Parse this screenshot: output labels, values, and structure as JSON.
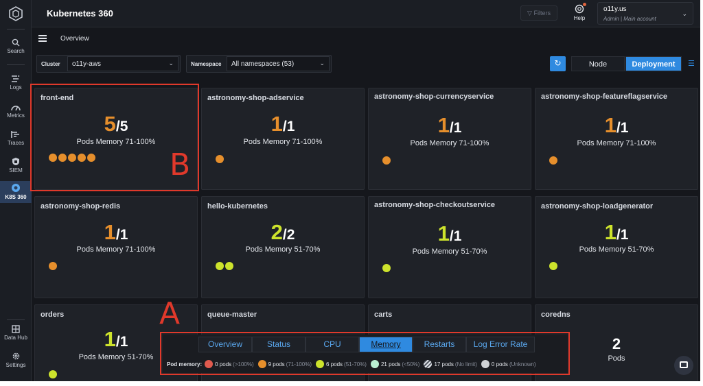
{
  "header": {
    "title": "Kubernetes 360",
    "filters_label": "Filters",
    "help_label": "Help",
    "account_name": "o11y.us",
    "account_sub": "Admin  |  Main account"
  },
  "sidebar": {
    "items": [
      {
        "label": "Search",
        "icon": "search-icon"
      },
      {
        "label": "Logs",
        "icon": "logs-icon"
      },
      {
        "label": "Metrics",
        "icon": "metrics-icon"
      },
      {
        "label": "Traces",
        "icon": "traces-icon"
      },
      {
        "label": "SIEM",
        "icon": "siem-icon"
      },
      {
        "label": "K8S 360",
        "icon": "k8s-icon"
      },
      {
        "label": "Data Hub",
        "icon": "data-hub-icon"
      },
      {
        "label": "Settings",
        "icon": "gear-icon"
      }
    ]
  },
  "breadcrumb": {
    "current": "Overview"
  },
  "filters": {
    "cluster_label": "Cluster",
    "cluster_value": "o11y-aws",
    "namespace_label": "Namespace",
    "namespace_value": "All namespaces (53)",
    "view_node": "Node",
    "view_deployment": "Deployment"
  },
  "cards": [
    {
      "title": "front-end",
      "ready": "5",
      "total": "/5",
      "caption": "Pods Memory 71-100%",
      "color": "orange",
      "dots": 5
    },
    {
      "title": "astronomy-shop-adservice",
      "ready": "1",
      "total": "/1",
      "caption": "Pods Memory 71-100%",
      "color": "orange",
      "dots": 1
    },
    {
      "title": "astronomy-shop-currencyservice",
      "ready": "1",
      "total": "/1",
      "caption": "Pods Memory 71-100%",
      "color": "orange",
      "dots": 1
    },
    {
      "title": "astronomy-shop-featureflagservice",
      "ready": "1",
      "total": "/1",
      "caption": "Pods Memory 71-100%",
      "color": "orange",
      "dots": 1
    },
    {
      "title": "astronomy-shop-redis",
      "ready": "1",
      "total": "/1",
      "caption": "Pods Memory 71-100%",
      "color": "orange",
      "dots": 1
    },
    {
      "title": "hello-kubernetes",
      "ready": "2",
      "total": "/2",
      "caption": "Pods Memory 51-70%",
      "color": "yellow",
      "dots": 2
    },
    {
      "title": "astronomy-shop-checkoutservice",
      "ready": "1",
      "total": "/1",
      "caption": "Pods Memory 51-70%",
      "color": "yellow",
      "dots": 1
    },
    {
      "title": "astronomy-shop-loadgenerator",
      "ready": "1",
      "total": "/1",
      "caption": "Pods Memory 51-70%",
      "color": "yellow",
      "dots": 1
    },
    {
      "title": "orders",
      "ready": "1",
      "total": "/1",
      "caption": "Pods Memory 51-70%",
      "color": "yellow",
      "dots": 1
    },
    {
      "title": "queue-master",
      "ready": "",
      "total": "",
      "caption": "",
      "color": "orange",
      "dots": 0
    },
    {
      "title": "carts",
      "ready": "",
      "total": "",
      "caption": "",
      "color": "orange",
      "dots": 0
    },
    {
      "title": "coredns",
      "ready": "2",
      "total": "",
      "caption": "Pods",
      "color": "white",
      "dots": 0
    }
  ],
  "annotations": {
    "a": "A",
    "b": "B"
  },
  "legend": {
    "tabs": [
      "Overview",
      "Status",
      "CPU",
      "Memory",
      "Restarts",
      "Log Error Rate"
    ],
    "active_tab": "Memory",
    "header": "Pod memory:",
    "entries": [
      {
        "count": "0 pods",
        "range": "(>100%)",
        "color": "#e05a4e"
      },
      {
        "count": "9 pods",
        "range": "(71-100%)",
        "color": "#e68f2c"
      },
      {
        "count": "6 pods",
        "range": "(51-70%)",
        "color": "#cde32c"
      },
      {
        "count": "21 pods",
        "range": "(<50%)",
        "color": "#b9efd2"
      },
      {
        "count": "17 pods",
        "range": "(No limit)",
        "color": "striped"
      },
      {
        "count": "0 pods",
        "range": "(Unknown)",
        "color": "#d0d2d6"
      }
    ]
  }
}
